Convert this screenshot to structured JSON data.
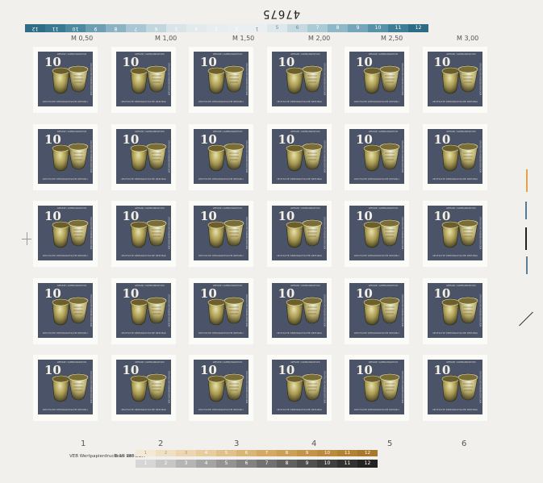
{
  "sheet": {
    "number": "47675",
    "top_bar_numbers": [
      "12",
      "11",
      "10",
      "9",
      "8",
      "7",
      "6",
      "5",
      "4",
      "3",
      "2",
      "1",
      "5",
      "6",
      "7",
      "8",
      "9",
      "10",
      "11",
      "12"
    ],
    "top_bar_colors": [
      "#2f6d86",
      "#3a7992",
      "#4d8aa1",
      "#6d9fb3",
      "#8cb3c4",
      "#a8c6d3",
      "#c2d6de",
      "#d8e4e8",
      "#e2eaec",
      "#e8eef0",
      "#eaf0f2",
      "#eaf0f2",
      "#dde8ec",
      "#c6d9e0",
      "#aacad5",
      "#8fb8c7",
      "#74a5b8",
      "#5892a8",
      "#3f7e97",
      "#2c6c87"
    ],
    "prices": [
      "M 0,50",
      "M 1,00",
      "M 1,50",
      "M 2,00",
      "M 2,50",
      "M 3,00"
    ],
    "column_markers": [
      "1",
      "2",
      "3",
      "4",
      "5",
      "6"
    ],
    "printer_line": "VEB Wertpapierdruckerei der DDR",
    "print_code": "B 15 185",
    "brown_bar_numbers": [
      "1",
      "2",
      "3",
      "4",
      "5",
      "6",
      "7",
      "8",
      "9",
      "10",
      "11",
      "12"
    ],
    "brown_bar_colors": [
      "#f3e9d6",
      "#efe0c4",
      "#ebd6b1",
      "#e6cc9e",
      "#e0c08b",
      "#d9b577",
      "#d2aa65",
      "#cb9f55",
      "#c39548",
      "#ba8b3d",
      "#b18234",
      "#a8792d"
    ],
    "gray_bar_numbers": [
      "1",
      "2",
      "3",
      "4",
      "5",
      "6",
      "7",
      "8",
      "9",
      "10",
      "11",
      "12"
    ],
    "gray_bar_colors": [
      "#d6d6d6",
      "#c6c6c6",
      "#b5b5b5",
      "#a4a4a4",
      "#939393",
      "#828282",
      "#717171",
      "#606060",
      "#505050",
      "#404040",
      "#313131",
      "#232323"
    ]
  },
  "stamp": {
    "value": "10",
    "country": "DEUTSCHE DEMOKRATISCHE REPUBLIK",
    "top_caption": "GEFÄSSE / SAMMLUNGSSTÜCK",
    "side_caption": "STAATLICHE MUSEEN DER DDR",
    "background_color": "#4b5368",
    "rows": 5,
    "columns": 6
  }
}
